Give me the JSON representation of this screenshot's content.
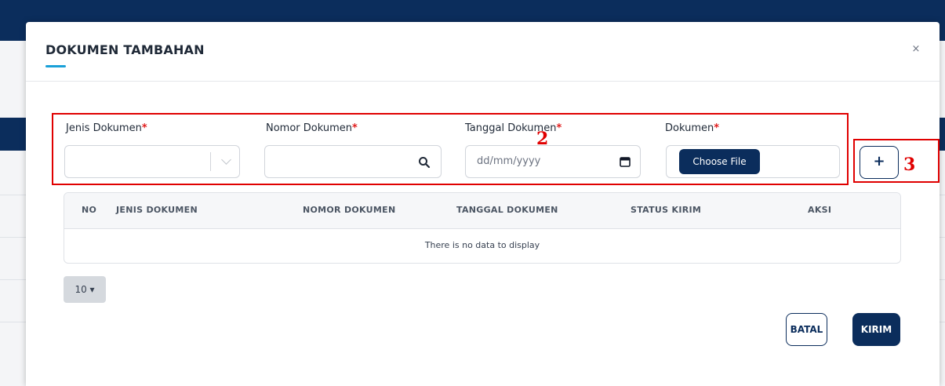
{
  "modal": {
    "title": "DOKUMEN TAMBAHAN",
    "close_icon": "×"
  },
  "form": {
    "jenis_label": "Jenis Dokumen",
    "nomor_label": "Nomor Dokumen",
    "tanggal_label": "Tanggal Dokumen",
    "dokumen_label": "Dokumen",
    "required_mark": "*",
    "date_placeholder": "dd/mm/yyyy",
    "choose_file_label": "Choose File",
    "add_label": "+"
  },
  "annotations": {
    "form_number": "2",
    "add_number": "3"
  },
  "table": {
    "columns": [
      "NO",
      "JENIS DOKUMEN",
      "NOMOR DOKUMEN",
      "TANGGAL DOKUMEN",
      "STATUS KIRIM",
      "AKSI"
    ],
    "empty_message": "There is no data to display"
  },
  "pagination": {
    "page_size": "10 ▾"
  },
  "actions": {
    "cancel_label": "BATAL",
    "submit_label": "KIRIM"
  },
  "colors": {
    "primary": "#0b2d5c",
    "accent": "#19a0d8",
    "required": "#e11d1d",
    "annotation": "#e00000"
  }
}
